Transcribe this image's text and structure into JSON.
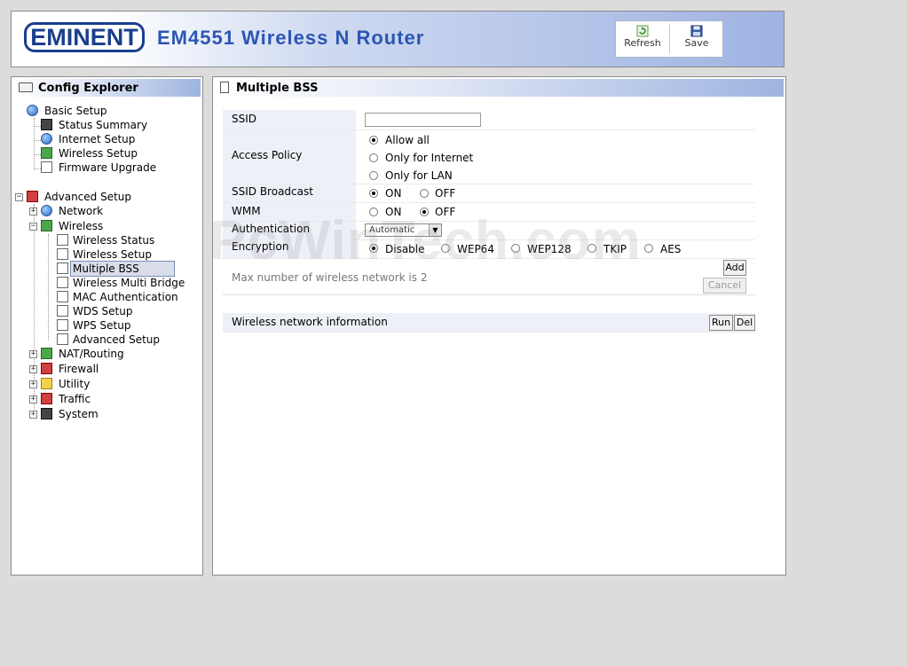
{
  "header": {
    "logo": "EMINENT",
    "title": "EM4551 Wireless N Router",
    "toolbar": {
      "refresh_label": "Refresh",
      "refresh_icon": "refresh-icon",
      "save_label": "Save",
      "save_icon": "floppy-disk-icon"
    }
  },
  "sidebar": {
    "title": "Config Explorer",
    "groups": [
      {
        "label": "Basic Setup",
        "items": [
          "Status Summary",
          "Internet Setup",
          "Wireless Setup",
          "Firmware Upgrade"
        ]
      },
      {
        "label": "Advanced Setup",
        "network": "Network",
        "wireless": {
          "label": "Wireless",
          "items": [
            "Wireless Status",
            "Wireless Setup",
            "Multiple BSS",
            "Wireless Multi Bridge",
            "MAC Authentication",
            "WDS Setup",
            "WPS Setup",
            "Advanced Setup"
          ],
          "selected": "Multiple BSS"
        },
        "others": [
          "NAT/Routing",
          "Firewall",
          "Utility",
          "Traffic",
          "System"
        ]
      }
    ]
  },
  "main": {
    "title": "Multiple BSS",
    "fields": {
      "ssid_label": "SSID",
      "ssid_value": "",
      "access_policy_label": "Access Policy",
      "access_policy_options": [
        "Allow all",
        "Only for Internet",
        "Only for LAN"
      ],
      "access_policy_selected": "Allow all",
      "ssid_broadcast_label": "SSID Broadcast",
      "on_label": "ON",
      "off_label": "OFF",
      "ssid_broadcast_selected": "ON",
      "wmm_label": "WMM",
      "wmm_selected": "OFF",
      "authentication_label": "Authentication",
      "authentication_value": "Automatic",
      "encryption_label": "Encryption",
      "encryption_options": [
        "Disable",
        "WEP64",
        "WEP128",
        "TKIP",
        "AES"
      ],
      "encryption_selected": "Disable"
    },
    "max_networks_text": "Max number of wireless network is 2",
    "add_label": "Add",
    "cancel_label": "Cancel",
    "network_info_label": "Wireless network information",
    "run_label": "Run",
    "del_label": "Del"
  },
  "watermark": "PcWinTech.com",
  "colors": {
    "header_gradient_end": "#9fb3e2",
    "title_blue": "#2d55b3",
    "logo_blue": "#1a3f8c",
    "label_bg": "#eef0f8"
  }
}
